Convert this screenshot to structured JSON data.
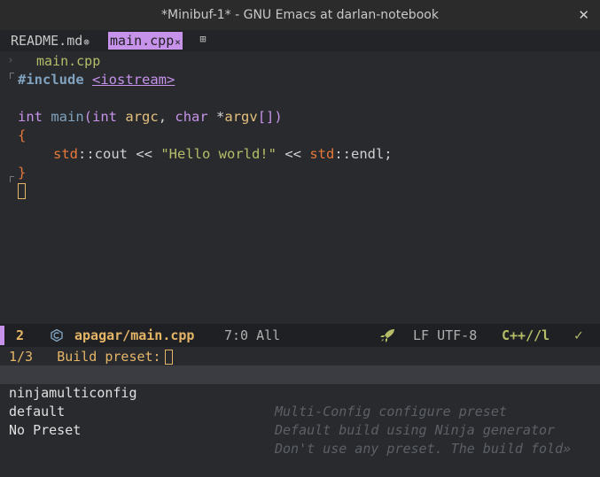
{
  "window": {
    "title": "*Minibuf-1* - GNU Emacs at darlan-notebook",
    "close_glyph": "✕"
  },
  "tabs": [
    {
      "label": "README.md",
      "close": "⊗"
    },
    {
      "label": "main.cpp",
      "close": "×"
    }
  ],
  "tab_add_glyph": "⊞",
  "header": {
    "chevron": "›",
    "filename": "main.cpp"
  },
  "code": {
    "l1_directive": "#include",
    "l1_header": "<iostream>",
    "l3_int1": "int",
    "l3_main": "main",
    "l3_open": "(",
    "l3_int2": "int",
    "l3_argc": "argc",
    "l3_comma": ", ",
    "l3_char": "char",
    "l3_star": "*",
    "l3_argv": "argv",
    "l3_brackets": "[]",
    "l3_close": ")",
    "l4_brace": "{",
    "l5_std1": "std",
    "l5_sep1": "::",
    "l5_cout": "cout",
    "l5_op1": " << ",
    "l5_str": "\"Hello world!\"",
    "l5_op2": " << ",
    "l5_std2": "std",
    "l5_sep2": "::",
    "l5_endl": "endl;",
    "l6_brace": "}"
  },
  "modeline": {
    "line_number": "2",
    "project": "apagar/",
    "file": "main.cpp",
    "position": "7:0 All",
    "encoding": "LF UTF-8",
    "major_mode": "C++//l",
    "check_glyph": "✓",
    "accent": "#c792ea"
  },
  "minibuffer": {
    "count": "1/3",
    "prompt": "Build preset:",
    "candidates": [
      {
        "name": "ninjamulticonfig",
        "desc": "Multi-Config configure preset"
      },
      {
        "name": "default",
        "desc": "Default build using Ninja generator"
      },
      {
        "name": "No Preset",
        "desc": "Don't use any preset. The build fold»"
      }
    ]
  }
}
